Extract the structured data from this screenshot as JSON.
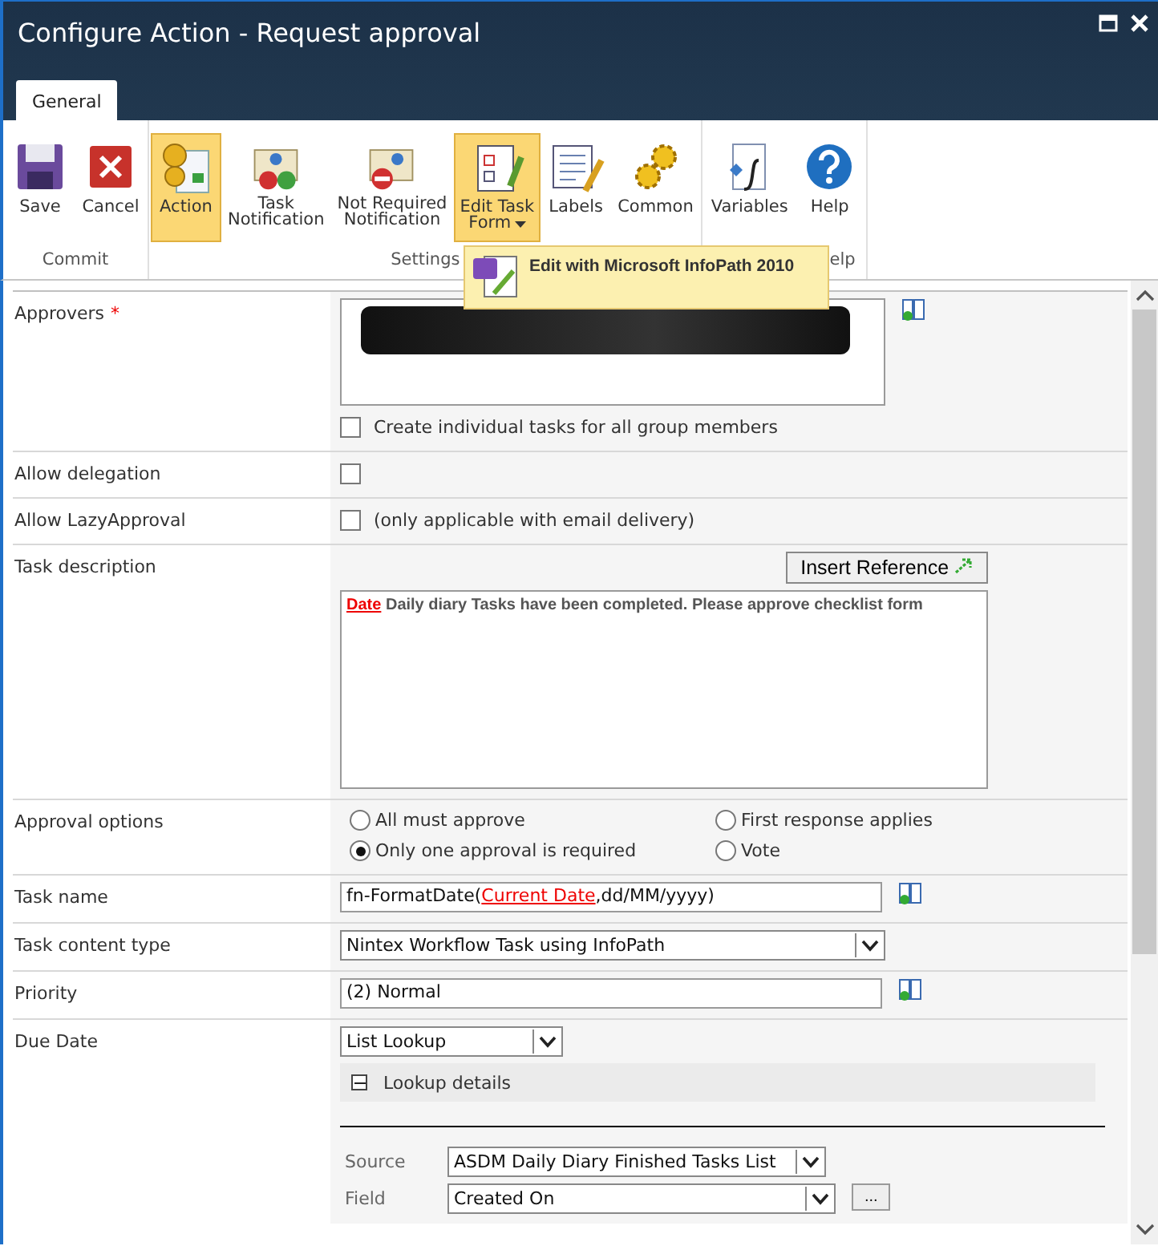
{
  "window": {
    "title": "Configure Action - Request approval"
  },
  "tabs": [
    {
      "label": "General",
      "selected": true
    }
  ],
  "ribbon": {
    "groups": [
      {
        "label": "Commit",
        "buttons": [
          {
            "label": "Save",
            "kind": "save",
            "selected": false,
            "has_menu": false
          },
          {
            "label": "Cancel",
            "kind": "cancel",
            "selected": false,
            "has_menu": false
          }
        ]
      },
      {
        "label": "Settings",
        "buttons": [
          {
            "label": "Action",
            "kind": "action",
            "selected": true,
            "has_menu": false
          },
          {
            "label": "Task\nNotification",
            "kind": "task-notification",
            "selected": false,
            "has_menu": false
          },
          {
            "label": "Not Required\nNotification",
            "kind": "not-required",
            "selected": false,
            "has_menu": false
          },
          {
            "label": "Edit Task\nForm",
            "kind": "edit-form",
            "selected": true,
            "has_menu": true
          },
          {
            "label": "Labels",
            "kind": "labels",
            "selected": false,
            "has_menu": false
          },
          {
            "label": "Common",
            "kind": "common",
            "selected": false,
            "has_menu": false
          }
        ]
      },
      {
        "label": "elp",
        "buttons": [
          {
            "label": "Variables",
            "kind": "variables",
            "selected": false,
            "has_menu": false
          },
          {
            "label": "Help",
            "kind": "help",
            "selected": false,
            "has_menu": false
          }
        ]
      }
    ]
  },
  "dropdown_menu": {
    "items": [
      {
        "label": "Edit with Microsoft InfoPath 2010"
      }
    ]
  },
  "form": {
    "rows": [
      {
        "kind": "people",
        "label": "Approvers",
        "required_mark": "*",
        "checkbox": {
          "label": "Create individual tasks for all group members",
          "checked": false
        }
      },
      {
        "kind": "checkbox",
        "label": "Allow delegation",
        "checkbox": {
          "checked": false
        }
      },
      {
        "kind": "checkbox",
        "label": "Allow LazyApproval",
        "checkbox": {
          "label": "(only applicable with email delivery)",
          "checked": false
        }
      },
      {
        "kind": "richtext",
        "label": "Task description",
        "button": "Insert Reference",
        "segments": [
          {
            "text": "Date",
            "kind": "reference"
          },
          {
            "text": " Daily diary Tasks have been completed. Please approve checklist form",
            "kind": "plain"
          }
        ]
      },
      {
        "kind": "radios",
        "label": "Approval options",
        "options": [
          {
            "label": "All must approve",
            "selected": false
          },
          {
            "label": "First response applies",
            "selected": false
          },
          {
            "label": "Only one approval is required",
            "selected": true
          },
          {
            "label": "Vote",
            "selected": false
          }
        ]
      },
      {
        "kind": "lookup-text",
        "label": "Task name",
        "segments": [
          {
            "text": "fn-FormatDate(",
            "kind": "plain"
          },
          {
            "text": "Current Date",
            "kind": "reference"
          },
          {
            "text": ",dd/MM/yyyy)",
            "kind": "plain"
          }
        ]
      },
      {
        "kind": "select",
        "label": "Task content type",
        "value": "Nintex Workflow Task using InfoPath"
      },
      {
        "kind": "lookup-text",
        "label": "Priority",
        "segments": [
          {
            "text": "(2) Normal",
            "kind": "plain"
          }
        ]
      },
      {
        "kind": "due",
        "label": "Due Date",
        "value": "List Lookup",
        "details": {
          "label": "Lookup details",
          "expanded": true,
          "fields": [
            {
              "label": "Source",
              "value": "ASDM Daily Diary Finished Tasks List"
            },
            {
              "label": "Field",
              "value": "Created On",
              "button": "..."
            }
          ]
        }
      }
    ]
  }
}
